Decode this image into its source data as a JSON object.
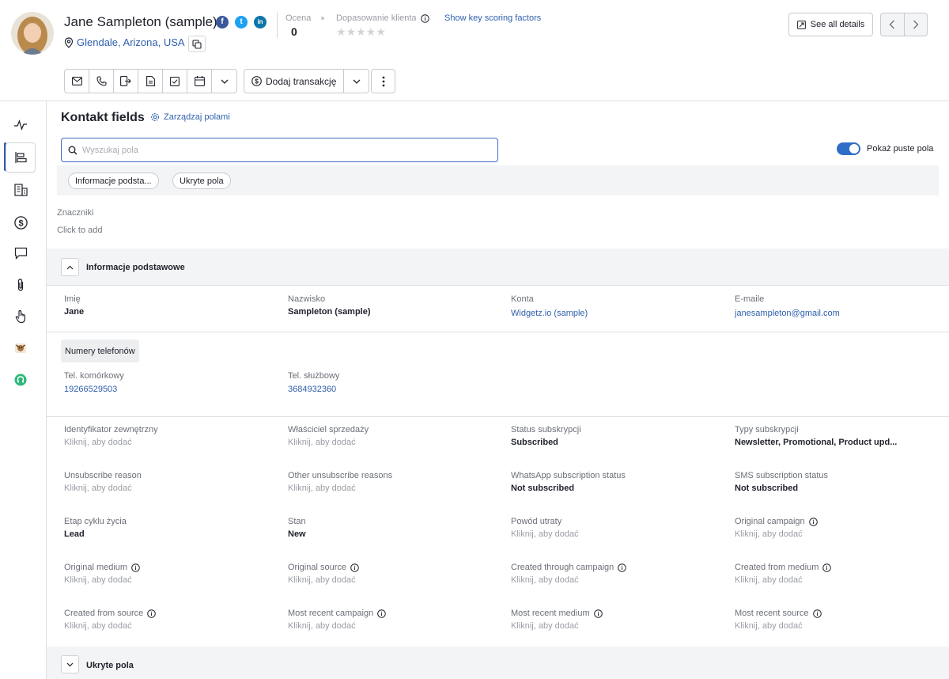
{
  "contact": {
    "name": "Jane Sampleton (sample)",
    "location": "Glendale, Arizona, USA"
  },
  "score": {
    "label": "Ocena",
    "value": "0"
  },
  "fit": {
    "label": "Dopasowanie klienta",
    "stars": "★★★★★"
  },
  "links": {
    "key_factors": "Show key scoring factors",
    "see_all": "See all details"
  },
  "social": {
    "facebook": "f",
    "twitter": "t",
    "linkedin": "in"
  },
  "toolbar": {
    "deal_label": "Dodaj transakcję"
  },
  "panel": {
    "title": "Kontakt fields",
    "manage": "Zarządzaj polami",
    "search_placeholder": "Wyszukaj pola",
    "show_empty": "Pokaż puste pola",
    "chips": [
      "Informacje podsta...",
      "Ukryte pola"
    ],
    "tags_label": "Znaczniki",
    "tags_value": "Click to add"
  },
  "sections": {
    "basic": "Informacje podstawowe",
    "phones": "Numery telefonów",
    "hidden": "Ukryte pola"
  },
  "fields": {
    "imie": {
      "label": "Imię",
      "value": "Jane"
    },
    "nazwisko": {
      "label": "Nazwisko",
      "value": "Sampleton (sample)"
    },
    "konta": {
      "label": "Konta",
      "value": "Widgetz.io (sample)"
    },
    "emaile": {
      "label": "E-maile",
      "value": "janesampleton@gmail.com"
    },
    "mobile": {
      "label": "Tel. komórkowy",
      "value": "19266529503"
    },
    "work": {
      "label": "Tel. służbowy",
      "value": "3684932360"
    },
    "ext_id": {
      "label": "Identyfikator zewnętrzny",
      "value": "Kliknij, aby dodać"
    },
    "owner": {
      "label": "Właściciel sprzedaży",
      "value": "Kliknij, aby dodać"
    },
    "sub_status": {
      "label": "Status subskrypcji",
      "value": "Subscribed"
    },
    "sub_types": {
      "label": "Typy subskrypcji",
      "value": "Newsletter, Promotional, Product upd..."
    },
    "unsub_reason": {
      "label": "Unsubscribe reason",
      "value": "Kliknij, aby dodać"
    },
    "other_unsub": {
      "label": "Other unsubscribe reasons",
      "value": "Kliknij, aby dodać"
    },
    "whatsapp": {
      "label": "WhatsApp subscription status",
      "value": "Not subscribed"
    },
    "sms": {
      "label": "SMS subscription status",
      "value": "Not subscribed"
    },
    "lifecycle": {
      "label": "Etap cyklu życia",
      "value": "Lead"
    },
    "stan": {
      "label": "Stan",
      "value": "New"
    },
    "lost_reason": {
      "label": "Powód utraty",
      "value": "Kliknij, aby dodać"
    },
    "orig_campaign": {
      "label": "Original campaign",
      "value": "Kliknij, aby dodać"
    },
    "orig_medium": {
      "label": "Original medium",
      "value": "Kliknij, aby dodać"
    },
    "orig_source": {
      "label": "Original source",
      "value": "Kliknij, aby dodać"
    },
    "created_campaign": {
      "label": "Created through campaign",
      "value": "Kliknij, aby dodać"
    },
    "created_medium": {
      "label": "Created from medium",
      "value": "Kliknij, aby dodać"
    },
    "created_source": {
      "label": "Created from source",
      "value": "Kliknij, aby dodać"
    },
    "recent_campaign": {
      "label": "Most recent campaign",
      "value": "Kliknij, aby dodać"
    },
    "recent_medium": {
      "label": "Most recent medium",
      "value": "Kliknij, aby dodać"
    },
    "recent_source": {
      "label": "Most recent source",
      "value": "Kliknij, aby dodać"
    }
  },
  "colors": {
    "accent": "#2f5fad",
    "facebook": "#3b5998",
    "twitter": "#1da1f2",
    "linkedin": "#0e76a8",
    "toggle": "#2f6ec6"
  }
}
